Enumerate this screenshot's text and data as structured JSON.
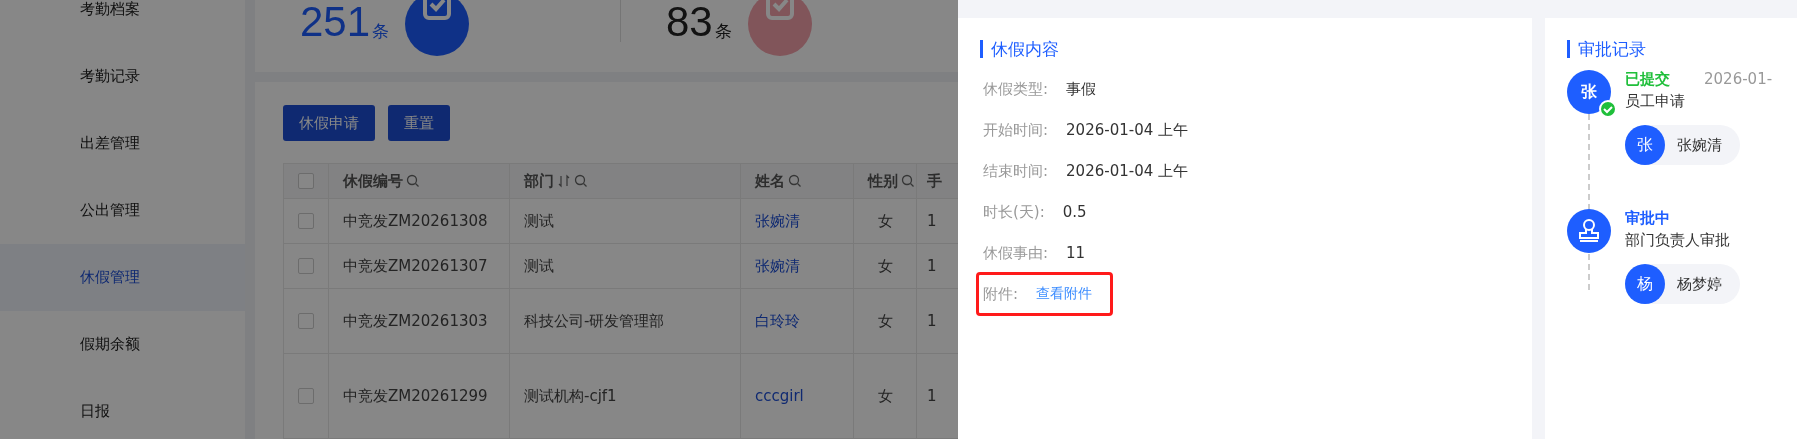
{
  "sidebar": {
    "items": [
      {
        "label": "考勤档案",
        "selected": false
      },
      {
        "label": "考勤记录",
        "selected": false
      },
      {
        "label": "出差管理",
        "selected": false
      },
      {
        "label": "公出管理",
        "selected": false
      },
      {
        "label": "休假管理",
        "selected": true
      },
      {
        "label": "假期余额",
        "selected": false
      },
      {
        "label": "日报",
        "selected": false
      }
    ]
  },
  "stats": [
    {
      "value": "251",
      "unit": "条",
      "kind": "approved"
    },
    {
      "value": "83",
      "unit": "条",
      "kind": "rejected"
    }
  ],
  "toolbar": {
    "buttons": [
      "休假申请",
      "重置"
    ]
  },
  "table": {
    "all_checked": false,
    "columns": [
      {
        "label": "休假编号",
        "sortable": false,
        "searchable": true
      },
      {
        "label": "部门",
        "sortable": true,
        "searchable": true
      },
      {
        "label": "姓名",
        "sortable": false,
        "searchable": true
      },
      {
        "label": "性别",
        "sortable": false,
        "searchable": true
      },
      {
        "label": "手",
        "sortable": false,
        "searchable": false
      }
    ],
    "rows": [
      {
        "checked": false,
        "cells": [
          "中竞发ZM20261308",
          "测试",
          "张婉清",
          "女",
          "1"
        ]
      },
      {
        "checked": false,
        "cells": [
          "中竞发ZM20261307",
          "测试",
          "张婉清",
          "女",
          "1"
        ]
      },
      {
        "checked": false,
        "cells": [
          "中竞发ZM20261303",
          "科技公司-研发管理部",
          "白玲玲",
          "女",
          "1"
        ]
      },
      {
        "checked": false,
        "cells": [
          "中竞发ZM20261299",
          "测试机构-cjf1",
          "cccgirl",
          "女",
          "1"
        ]
      }
    ]
  },
  "drawer": {
    "details": {
      "title": "休假内容",
      "fields": [
        {
          "label": "休假类型:",
          "value": "事假",
          "kind": "text",
          "highlighted": false
        },
        {
          "label": "开始时间:",
          "value": "2026-01-04 上午",
          "kind": "text",
          "highlighted": false
        },
        {
          "label": "结束时间:",
          "value": "2026-01-04 上午",
          "kind": "text",
          "highlighted": false
        },
        {
          "label": "时长(天):",
          "value": "0.5",
          "kind": "text",
          "highlighted": false
        },
        {
          "label": "休假事由:",
          "value": "11",
          "kind": "text",
          "highlighted": false
        },
        {
          "label": "附件:",
          "value": "查看附件",
          "kind": "link",
          "highlighted": true
        }
      ]
    },
    "approval": {
      "title": "审批记录",
      "steps": [
        {
          "status": "已提交",
          "kind": "done",
          "time": "2026-01-",
          "avatar": "张",
          "description": "员工申请",
          "approver": {
            "avatar": "张",
            "name": "张婉清"
          }
        },
        {
          "status": "审批中",
          "kind": "pending",
          "description": "部门负责人审批",
          "approver": {
            "avatar": "杨",
            "name": "杨梦婷"
          }
        }
      ]
    }
  }
}
